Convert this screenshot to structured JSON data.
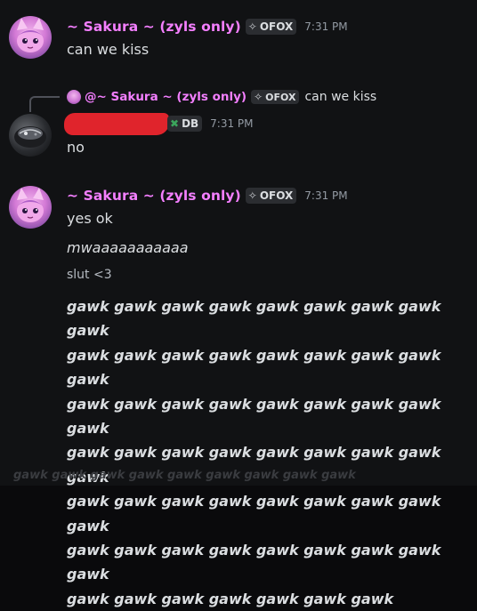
{
  "messages": [
    {
      "username": "~ Sakura ~ (zyls only)",
      "tag_icon": "✧",
      "tag": "OFOX",
      "timestamp": "7:31 PM",
      "lines": [
        "can we kiss"
      ]
    },
    {
      "reply": {
        "username": "@~ Sakura ~ (zyls only)",
        "tag_icon": "✧",
        "tag": "OFOX",
        "text": "can we kiss"
      },
      "tag_icon": "✖",
      "tag": "DB",
      "timestamp": "7:31 PM",
      "lines": [
        "no"
      ]
    },
    {
      "username": "~ Sakura ~ (zyls only)",
      "tag_icon": "✧",
      "tag": "OFOX",
      "timestamp": "7:31 PM",
      "lines": [
        "yes ok",
        "mwaaaaaaaaaaa",
        "slut <3"
      ],
      "gawk_lines": [
        "gawk gawk gawk gawk gawk gawk gawk gawk gawk",
        "gawk gawk gawk gawk gawk gawk gawk gawk gawk",
        "gawk gawk gawk gawk gawk gawk gawk gawk gawk",
        "gawk gawk gawk gawk gawk gawk gawk gawk gawk",
        "gawk gawk gawk gawk gawk gawk gawk gawk gawk",
        "gawk gawk gawk gawk gawk gawk gawk gawk gawk",
        "gawk gawk gawk gawk gawk gawk gawk"
      ]
    }
  ],
  "ghost_text": "gawk gawk gawk gawk gawk gawk gawk gawk gawk",
  "colors": {
    "username": "#f47fff",
    "redaction": "#e0242c",
    "background": "#111214"
  }
}
